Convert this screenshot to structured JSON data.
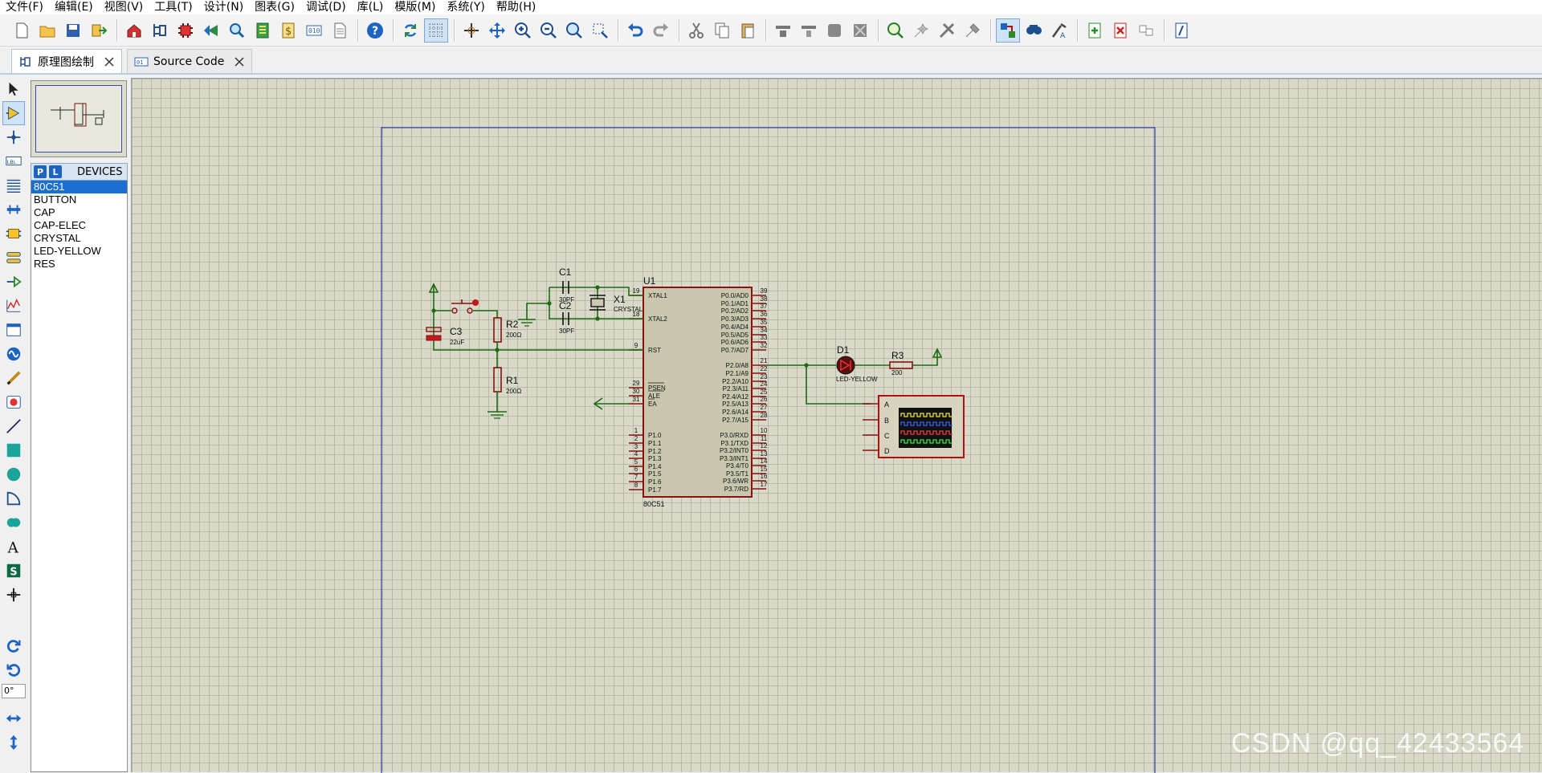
{
  "menu": [
    "文件(F)",
    "编辑(E)",
    "视图(V)",
    "工具(T)",
    "设计(N)",
    "图表(G)",
    "调试(D)",
    "库(L)",
    "模版(M)",
    "系统(Y)",
    "帮助(H)"
  ],
  "toolbar": {
    "groups": [
      [
        "new-file-icon",
        "open-folder-icon",
        "save-icon",
        "import-icon"
      ],
      [
        "home-icon",
        "schematic-icon",
        "chip-icon",
        "back-icon",
        "zoom-icon",
        "pcb-icon",
        "dollar-icon",
        "binary-icon",
        "document-icon"
      ],
      [
        "help-icon"
      ],
      [
        "refresh-icon",
        "grid-icon"
      ],
      [
        "origin-icon",
        "pan-icon",
        "zoom-in-icon",
        "zoom-out-icon",
        "zoom-all-icon",
        "zoom-area-icon"
      ],
      [
        "undo-icon",
        "redo-icon"
      ],
      [
        "cut-icon",
        "copy-icon",
        "paste-icon"
      ],
      [
        "block-copy-icon",
        "block-move-icon",
        "block-rotate-icon",
        "block-delete-icon"
      ],
      [
        "pick-device-icon",
        "make-device-icon",
        "decompose-icon",
        "package-icon"
      ],
      [
        "wire-autoroute-icon",
        "search-icon",
        "property-assign-icon"
      ],
      [
        "new-sheet-icon",
        "delete-sheet-icon",
        "sub-circuit-icon"
      ],
      [
        "netlist-icon"
      ]
    ]
  },
  "tabs": [
    {
      "label": "原理图绘制",
      "active": true
    },
    {
      "label": "Source Code",
      "active": false
    }
  ],
  "left_tools": [
    "select-mode-icon",
    "component-mode-icon",
    "junction-icon",
    "label-icon",
    "text-script-icon",
    "bus-icon",
    "subcircuit-icon",
    "terminal-icon",
    "pin-icon",
    "graph-icon",
    "tape-icon",
    "generator-icon",
    "probe-icon",
    "instrument-icon",
    "line-icon",
    "box-icon",
    "circle-icon",
    "arc-icon",
    "path-icon",
    "text-icon",
    "symbol-icon",
    "marker-icon"
  ],
  "rotation": {
    "angle": "0°",
    "tools": [
      "rotate-cw-icon",
      "rotate-ccw-icon",
      "mirror-x-icon",
      "mirror-y-icon"
    ]
  },
  "devices": {
    "p_button": "P",
    "l_button": "L",
    "title": "DEVICES",
    "items": [
      "80C51",
      "BUTTON",
      "CAP",
      "CAP-ELEC",
      "CRYSTAL",
      "LED-YELLOW",
      "RES"
    ],
    "selected": "80C51"
  },
  "schematic": {
    "u1": {
      "ref": "U1",
      "part": "80C51",
      "left_pins": [
        {
          "num": "19",
          "name": "XTAL1"
        },
        {
          "num": "18",
          "name": "XTAL2"
        },
        {
          "num": "9",
          "name": "RST"
        },
        {
          "num": "29",
          "name": "PSEN"
        },
        {
          "num": "30",
          "name": "ALE"
        },
        {
          "num": "31",
          "name": "EA"
        },
        {
          "num": "1",
          "name": "P1.0"
        },
        {
          "num": "2",
          "name": "P1.1"
        },
        {
          "num": "3",
          "name": "P1.2"
        },
        {
          "num": "4",
          "name": "P1.3"
        },
        {
          "num": "5",
          "name": "P1.4"
        },
        {
          "num": "6",
          "name": "P1.5"
        },
        {
          "num": "7",
          "name": "P1.6"
        },
        {
          "num": "8",
          "name": "P1.7"
        }
      ],
      "right_pins": [
        {
          "num": "39",
          "name": "P0.0/AD0"
        },
        {
          "num": "38",
          "name": "P0.1/AD1"
        },
        {
          "num": "37",
          "name": "P0.2/AD2"
        },
        {
          "num": "36",
          "name": "P0.3/AD3"
        },
        {
          "num": "35",
          "name": "P0.4/AD4"
        },
        {
          "num": "34",
          "name": "P0.5/AD5"
        },
        {
          "num": "33",
          "name": "P0.6/AD6"
        },
        {
          "num": "32",
          "name": "P0.7/AD7"
        },
        {
          "num": "21",
          "name": "P2.0/A8"
        },
        {
          "num": "22",
          "name": "P2.1/A9"
        },
        {
          "num": "23",
          "name": "P2.2/A10"
        },
        {
          "num": "24",
          "name": "P2.3/A11"
        },
        {
          "num": "25",
          "name": "P2.4/A12"
        },
        {
          "num": "26",
          "name": "P2.5/A13"
        },
        {
          "num": "27",
          "name": "P2.6/A14"
        },
        {
          "num": "28",
          "name": "P2.7/A15"
        },
        {
          "num": "10",
          "name": "P3.0/RXD"
        },
        {
          "num": "11",
          "name": "P3.1/TXD"
        },
        {
          "num": "12",
          "name": "P3.2/INT0"
        },
        {
          "num": "13",
          "name": "P3.3/INT1"
        },
        {
          "num": "14",
          "name": "P3.4/T0"
        },
        {
          "num": "15",
          "name": "P3.5/T1"
        },
        {
          "num": "16",
          "name": "P3.6/WR"
        },
        {
          "num": "17",
          "name": "P3.7/RD"
        }
      ]
    },
    "c1": {
      "ref": "C1",
      "value": "30PF"
    },
    "c2": {
      "ref": "C2",
      "value": "30PF"
    },
    "c3": {
      "ref": "C3",
      "value": "22uF"
    },
    "x1": {
      "ref": "X1",
      "value": "CRYSTAL"
    },
    "r1": {
      "ref": "R1",
      "value": "200Ω"
    },
    "r2": {
      "ref": "R2",
      "value": "200Ω"
    },
    "r3": {
      "ref": "R3",
      "value": "200"
    },
    "d1": {
      "ref": "D1",
      "value": "LED-YELLOW"
    },
    "scope": {
      "channels": [
        "A",
        "B",
        "C",
        "D"
      ]
    }
  },
  "colors": {
    "wire": "#1e6b12",
    "component": "#8b1010",
    "chip_fill": "#c9c8af",
    "sheet_border": "#2d3aa6",
    "grid_bg": "#d8d9c8"
  },
  "watermark": "CSDN @qq_42433564"
}
